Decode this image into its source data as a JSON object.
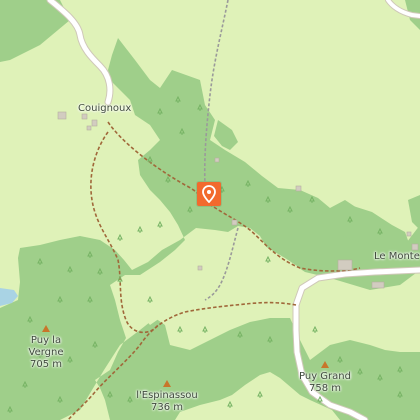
{
  "places": {
    "couignoux": "Couignoux",
    "le_monte": "Le Monte"
  },
  "peaks": [
    {
      "name": "Puy la Vergne",
      "line1": "Puy la",
      "line2": "Vergne",
      "elevation": "705 m"
    },
    {
      "name": "l'Espinassou",
      "line1": "l'Espinassou",
      "elevation": "736 m"
    },
    {
      "name": "Puy Grand",
      "line1": "Puy Grand",
      "elevation": "758 m"
    }
  ],
  "marker": {
    "icon": "location-pin-icon",
    "color": "#f26a2d"
  },
  "colors": {
    "meadow": "#dff2b8",
    "forest": "#9fcf8a",
    "water": "#a9d3e4",
    "road": "#ffffff",
    "trail": "#a0683a",
    "peak": "#c8762a"
  }
}
